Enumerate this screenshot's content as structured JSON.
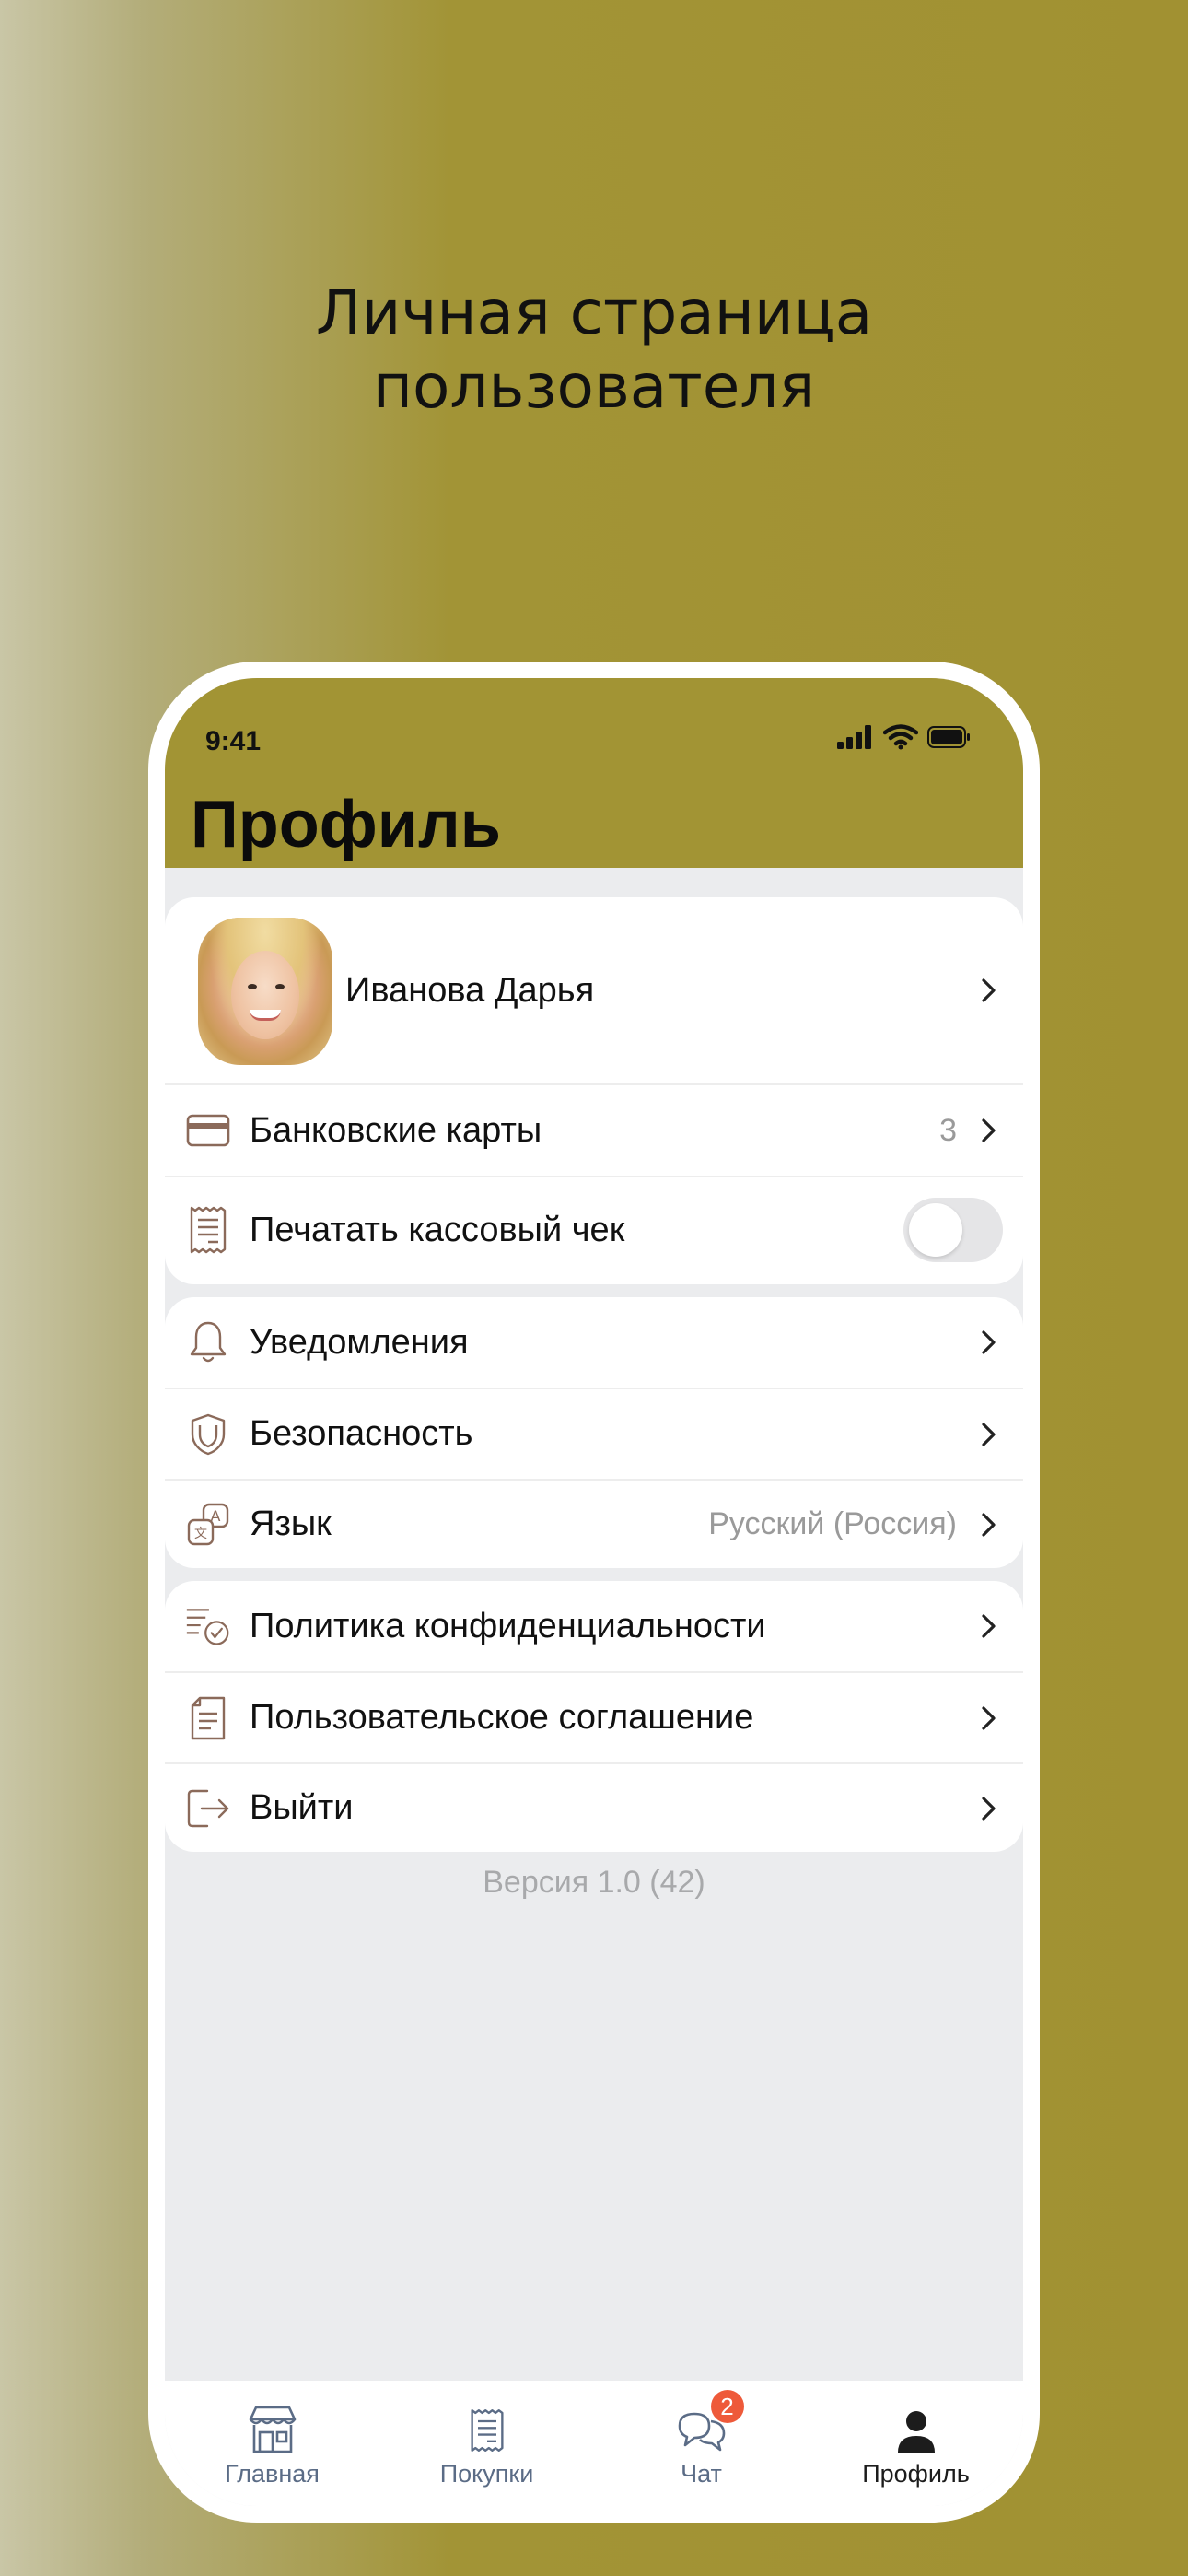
{
  "headline": {
    "line1": "Личная страница",
    "line2": "пользователя"
  },
  "status_bar": {
    "time": "9:41",
    "icons": [
      "signal-icon",
      "wifi-icon",
      "battery-icon"
    ]
  },
  "page_title": "Профиль",
  "profile": {
    "name": "Иванова Дарья"
  },
  "section1": [
    {
      "icon": "credit-card-icon",
      "label": "Банковские карты",
      "value": "3",
      "type": "chevron"
    },
    {
      "icon": "receipt-icon",
      "label": "Печатать кассовый чек",
      "toggle_on": false,
      "type": "toggle"
    }
  ],
  "section2": [
    {
      "icon": "bell-icon",
      "label": "Уведомления",
      "type": "chevron"
    },
    {
      "icon": "shield-icon",
      "label": "Безопасность",
      "type": "chevron"
    },
    {
      "icon": "translate-icon",
      "label": "Язык",
      "value": "Русский (Россия)",
      "type": "chevron"
    }
  ],
  "section3": [
    {
      "icon": "policy-check-icon",
      "label": "Политика конфиденциальности",
      "type": "chevron"
    },
    {
      "icon": "document-icon",
      "label": "Пользовательское соглашение",
      "type": "chevron"
    },
    {
      "icon": "logout-icon",
      "label": "Выйти",
      "type": "chevron"
    }
  ],
  "version": "Версия 1.0 (42)",
  "tabbar": {
    "tabs": [
      {
        "label": "Главная",
        "icon": "store-icon",
        "active": false
      },
      {
        "label": "Покупки",
        "icon": "receipt-icon",
        "active": false
      },
      {
        "label": "Чат",
        "icon": "chat-icon",
        "active": false,
        "badge": "2"
      },
      {
        "label": "Профиль",
        "icon": "person-icon",
        "active": true
      }
    ]
  },
  "colors": {
    "brand": "#a29434",
    "icon_brown": "#8b6a5a",
    "badge": "#ee5a3a",
    "tab_inactive": "#5b6c86"
  }
}
